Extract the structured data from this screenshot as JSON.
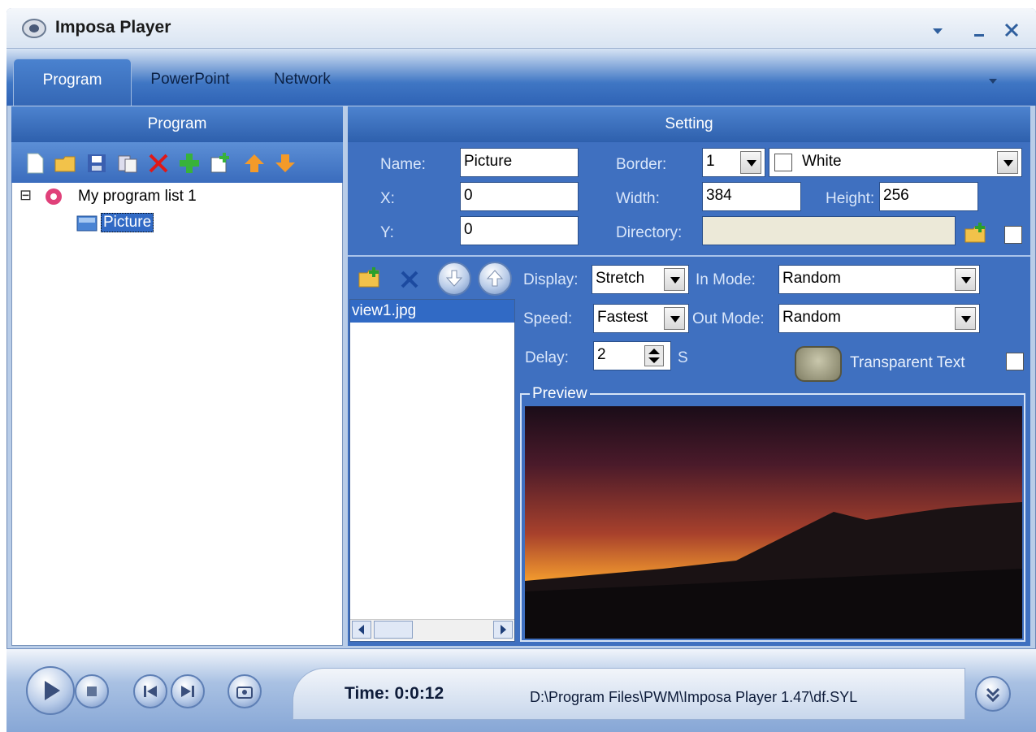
{
  "window": {
    "title": "Imposa Player"
  },
  "tabs": [
    {
      "label": "Program",
      "active": true
    },
    {
      "label": "PowerPoint",
      "active": false
    },
    {
      "label": "Network",
      "active": false
    }
  ],
  "left_panel": {
    "header": "Program",
    "toolbar_icons": [
      "new-icon",
      "open-folder-icon",
      "save-icon",
      "copy-icon",
      "delete-icon",
      "add-icon",
      "add-item-icon",
      "move-up-icon",
      "move-down-icon"
    ],
    "tree": {
      "root": "My program list 1",
      "children": [
        "Picture"
      ],
      "expander": "⊟"
    }
  },
  "setting": {
    "header": "Setting",
    "name_label": "Name:",
    "name_value": "Picture",
    "x_label": "X:",
    "x_value": "0",
    "y_label": "Y:",
    "y_value": "0",
    "border_label": "Border:",
    "border_value": "1",
    "border_color": "White",
    "width_label": "Width:",
    "width_value": "384",
    "height_label": "Height:",
    "height_value": "256",
    "directory_label": "Directory:",
    "directory_value": "",
    "file_list": [
      "view1.jpg"
    ],
    "display_label": "Display:",
    "display_value": "Stretch",
    "in_mode_label": "In Mode:",
    "in_mode_value": "Random",
    "speed_label": "Speed:",
    "speed_value": "Fastest",
    "out_mode_label": "Out Mode:",
    "out_mode_value": "Random",
    "delay_label": "Delay:",
    "delay_value": "2",
    "delay_unit": "S",
    "transparent_label": "Transparent Text",
    "preview_label": "Preview"
  },
  "status": {
    "time": "Time: 0:0:12",
    "path": "D:\\Program Files\\PWM\\Imposa Player 1.47\\df.SYL"
  },
  "colors": {
    "accent": "#3f70c0",
    "header": "#2e60ad",
    "selection": "#316ac5"
  }
}
